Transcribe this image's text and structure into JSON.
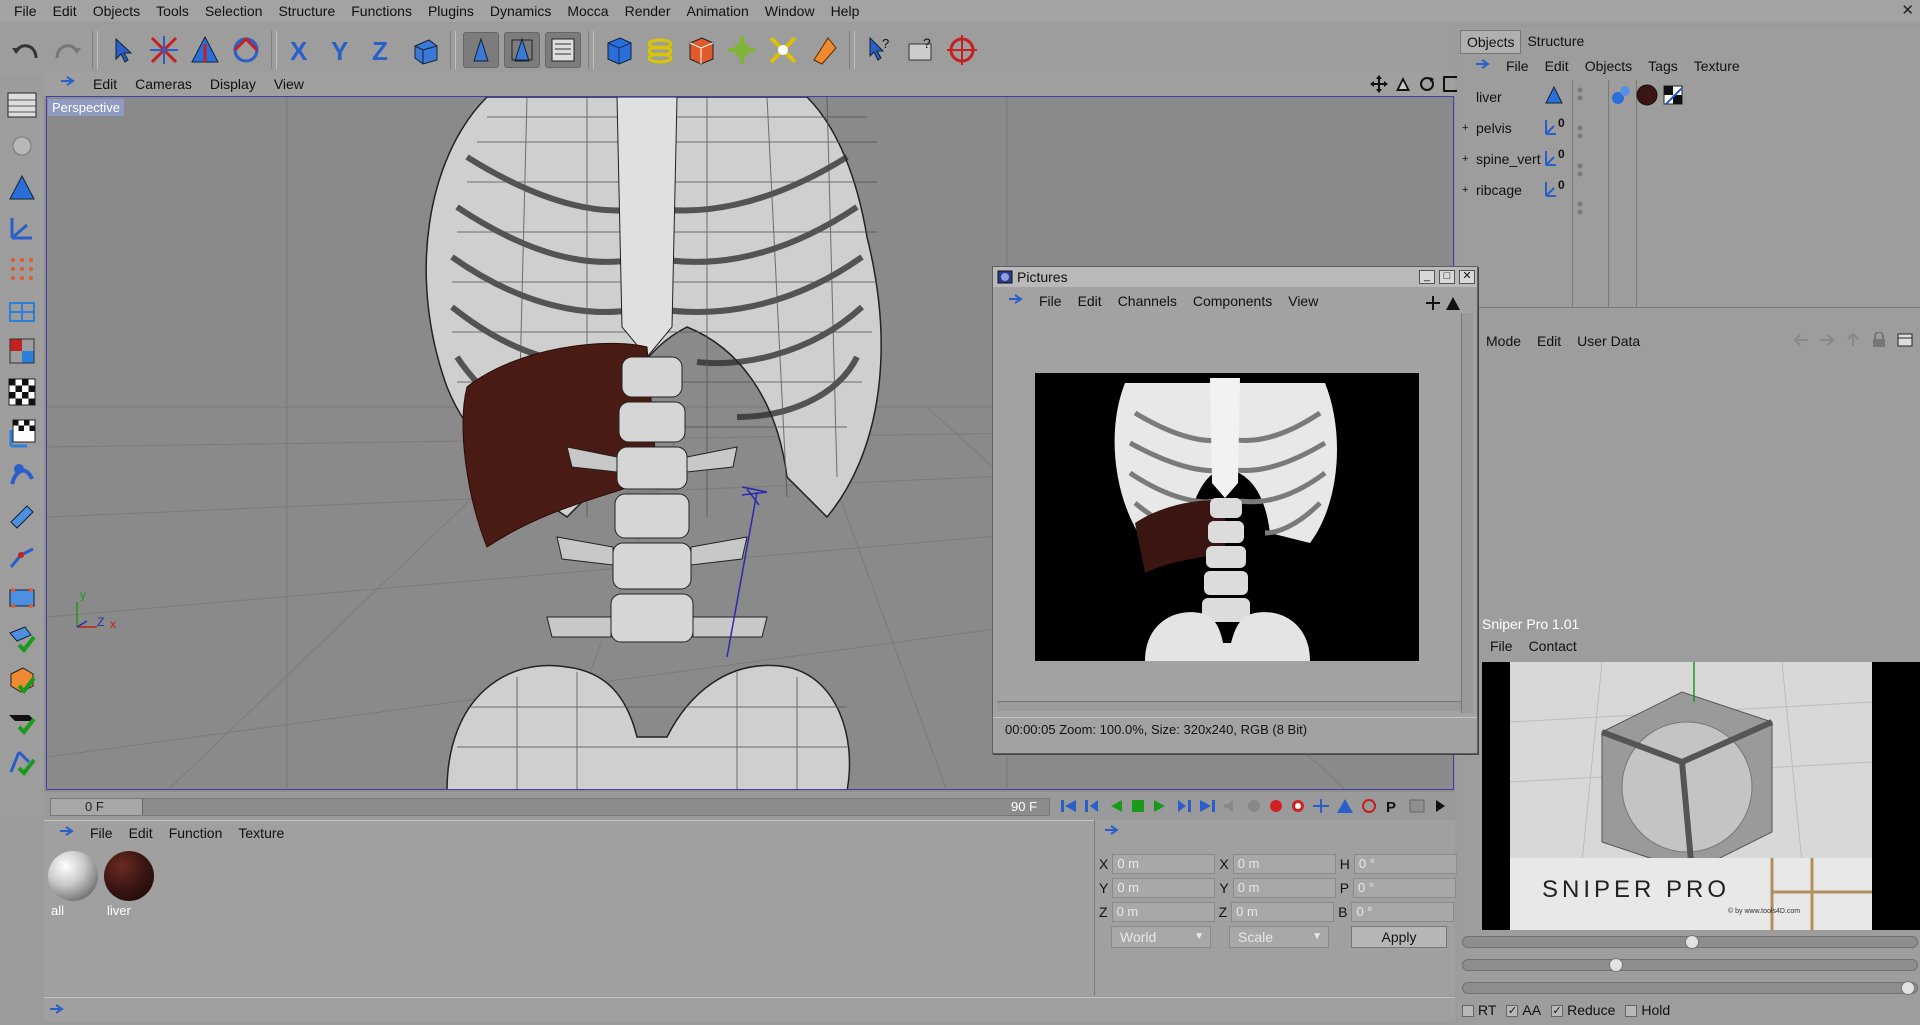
{
  "menubar": {
    "items": [
      "File",
      "Edit",
      "Objects",
      "Tools",
      "Selection",
      "Structure",
      "Functions",
      "Plugins",
      "Dynamics",
      "Mocca",
      "Render",
      "Animation",
      "Window",
      "Help"
    ],
    "close_glyph": "✕"
  },
  "viewport": {
    "menu": [
      "Edit",
      "Cameras",
      "Display",
      "View"
    ],
    "camera_label": "Perspective",
    "axis_labels": {
      "y": "y",
      "z": "Z",
      "x": "x"
    }
  },
  "timeline": {
    "current_frame": "0 F",
    "end_frame": "90 F"
  },
  "material_manager": {
    "menu": [
      "File",
      "Edit",
      "Function",
      "Texture"
    ],
    "materials": [
      {
        "label": "all",
        "color": "#d8d8d8"
      },
      {
        "label": "liver",
        "color": "#3a1512"
      }
    ]
  },
  "coordinates": {
    "rows": [
      {
        "a": "X",
        "a_val": "0 m",
        "b": "X",
        "b_val": "0 m",
        "c": "H",
        "c_val": "0 °"
      },
      {
        "a": "Y",
        "a_val": "0 m",
        "b": "Y",
        "b_val": "0 m",
        "c": "P",
        "c_val": "0 °"
      },
      {
        "a": "Z",
        "a_val": "0 m",
        "b": "Z",
        "b_val": "0 m",
        "c": "B",
        "c_val": "0 °"
      }
    ],
    "mode_select": "World",
    "type_select": "Scale",
    "apply_label": "Apply"
  },
  "object_manager": {
    "tabs": [
      "Objects",
      "Structure"
    ],
    "menu": [
      "File",
      "Edit",
      "Objects",
      "Tags",
      "Texture"
    ],
    "objects": [
      {
        "name": "liver",
        "expandable": false
      },
      {
        "name": "pelvis",
        "expandable": true
      },
      {
        "name": "spine_vert",
        "expandable": true
      },
      {
        "name": "ribcage",
        "expandable": true
      }
    ],
    "null_marker": "0"
  },
  "attribute_manager": {
    "menu": [
      "Mode",
      "Edit",
      "User Data"
    ]
  },
  "sniper": {
    "title": "Sniper Pro 1.01",
    "menu": [
      "File",
      "Contact"
    ],
    "logo_text": "SNIPER PRO",
    "credit": "© by www.tools4D.com",
    "render_options": [
      {
        "label": "RT",
        "checked": false
      },
      {
        "label": "AA",
        "checked": true
      },
      {
        "label": "Reduce",
        "checked": true
      },
      {
        "label": "Hold",
        "checked": false
      }
    ]
  },
  "pictures_window": {
    "title": "Pictures",
    "menu": [
      "File",
      "Edit",
      "Channels",
      "Components",
      "View"
    ],
    "status": "00:00:05   Zoom: 100.0%, Size: 320x240, RGB (8 Bit)"
  },
  "colors": {
    "viewport_border": "#3f3fb0",
    "liver": "#4a1a14",
    "ui_gray": "#9d9d9d"
  }
}
